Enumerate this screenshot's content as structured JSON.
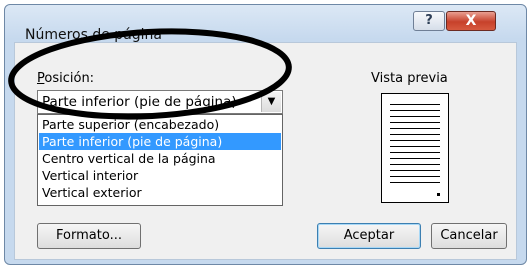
{
  "dialog": {
    "title": "Números de página",
    "help_glyph": "?",
    "close_glyph": "X"
  },
  "position": {
    "label": "Posición:",
    "selected": "Parte inferior (pie de página)",
    "options": [
      "Parte superior (encabezado)",
      "Parte inferior (pie de página)",
      "Centro vertical de la página",
      "Vertical interior",
      "Vertical exterior"
    ],
    "highlighted_index": 1
  },
  "preview": {
    "label": "Vista previa"
  },
  "buttons": {
    "formato": "Formato...",
    "aceptar": "Aceptar",
    "cancelar": "Cancelar"
  },
  "colors": {
    "highlight": "#3399ff",
    "annotation_oval": "#000000"
  },
  "icons": {
    "combo_arrow": "chevron-down-icon"
  }
}
